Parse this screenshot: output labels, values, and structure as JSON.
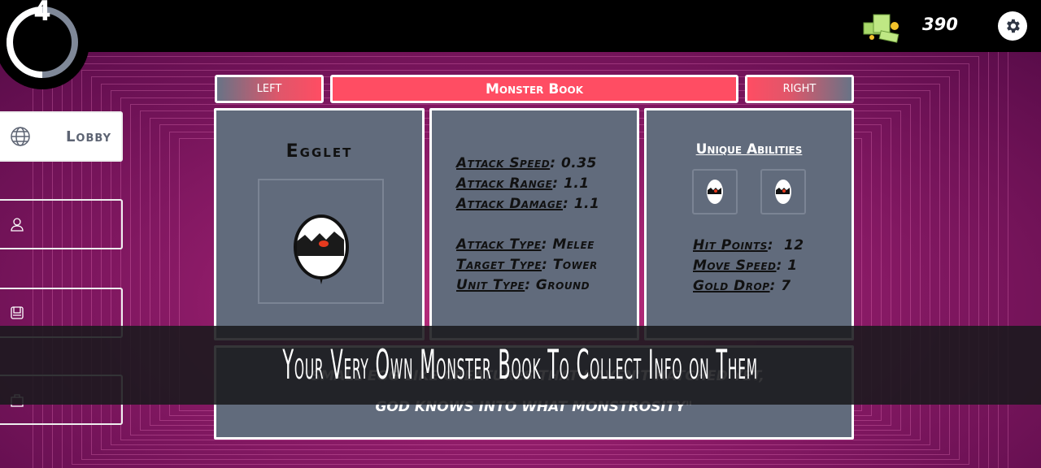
{
  "hud": {
    "level": "4",
    "level_progress": 0.5,
    "coins": "390"
  },
  "sidebar": {
    "lobby_label": "Lobby"
  },
  "nav": {
    "left": "LEFT",
    "title": "Monster Book",
    "right": "RIGHT"
  },
  "monster": {
    "name": "Egglet",
    "stats": [
      {
        "label": "Attack Speed",
        "value": "0.35"
      },
      {
        "label": "Attack Range",
        "value": "1.1"
      },
      {
        "label": "Attack Damage",
        "value": "1.1"
      },
      {
        "label": "Attack Type",
        "value": "Melee"
      },
      {
        "label": "Target Type",
        "value": "Tower"
      },
      {
        "label": "Unit Type",
        "value": "Ground"
      }
    ],
    "abilities_title": "Unique Abilities",
    "vitals": [
      {
        "label": "Hit Points",
        "value": "12"
      },
      {
        "label": "Move Speed",
        "value": "1"
      },
      {
        "label": "Gold Drop",
        "value": "7"
      }
    ],
    "description": "\"Small egg like creatures that haven't hatched yet, god knows into what monstrosity\""
  },
  "caption": "Your Very Own Monster Book To Collect Info on Them",
  "colors": {
    "accent": "#ff4d63",
    "panel": "#616b7c",
    "background": "#9b1f72"
  }
}
